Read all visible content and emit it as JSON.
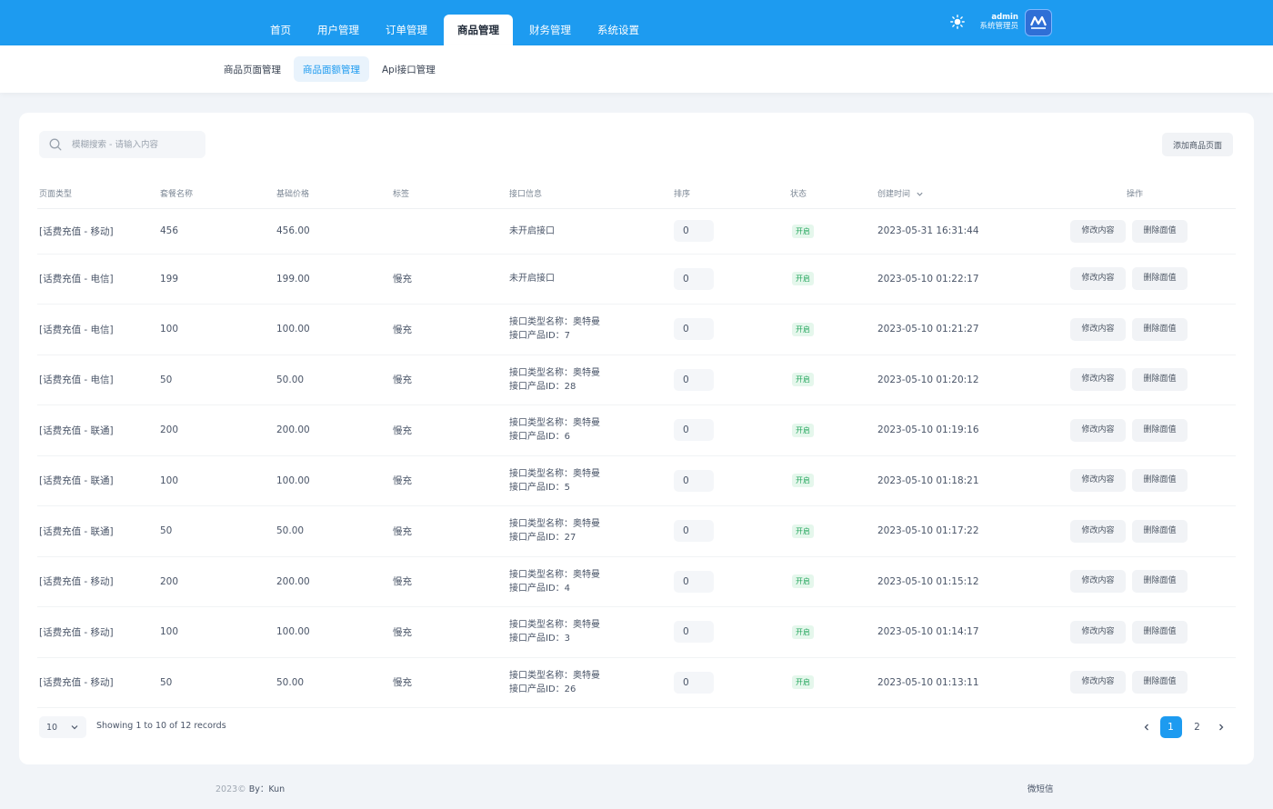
{
  "colors": {
    "primary": "#1d9bf0",
    "status_green": "#22a55b"
  },
  "nav": {
    "items": [
      "首页",
      "用户管理",
      "订单管理",
      "商品管理",
      "财务管理",
      "系统设置"
    ],
    "active": "商品管理"
  },
  "user": {
    "name": "admin",
    "role": "系统管理员",
    "avatar_icon": "logo-avatar-icon",
    "theme_icon": "sun-icon"
  },
  "subnav": {
    "items": [
      "商品页面管理",
      "商品面额管理",
      "Api接口管理"
    ],
    "active": "商品面额管理"
  },
  "toolbar": {
    "search_placeholder": "模糊搜索 - 请输入内容",
    "add_label": "添加商品页面"
  },
  "table": {
    "headers": [
      "页面类型",
      "套餐名称",
      "基础价格",
      "标签",
      "接口信息",
      "排序",
      "状态",
      "创建时间",
      "操作"
    ],
    "rows": [
      {
        "type": "[话费充值 - 移动]",
        "name": "456",
        "price": "456.00",
        "tag": "",
        "api1": "未开启接口",
        "api2": "",
        "sort": "0",
        "status": "开启",
        "time": "2023-05-31 16:31:44"
      },
      {
        "type": "[话费充值 - 电信]",
        "name": "199",
        "price": "199.00",
        "tag": "慢充",
        "api1": "未开启接口",
        "api2": "",
        "sort": "0",
        "status": "开启",
        "time": "2023-05-10 01:22:17"
      },
      {
        "type": "[话费充值 - 电信]",
        "name": "100",
        "price": "100.00",
        "tag": "慢充",
        "api1": "接口类型名称：奥特曼",
        "api2": "接口产品ID：7",
        "sort": "0",
        "status": "开启",
        "time": "2023-05-10 01:21:27"
      },
      {
        "type": "[话费充值 - 电信]",
        "name": "50",
        "price": "50.00",
        "tag": "慢充",
        "api1": "接口类型名称：奥特曼",
        "api2": "接口产品ID：28",
        "sort": "0",
        "status": "开启",
        "time": "2023-05-10 01:20:12"
      },
      {
        "type": "[话费充值 - 联通]",
        "name": "200",
        "price": "200.00",
        "tag": "慢充",
        "api1": "接口类型名称：奥特曼",
        "api2": "接口产品ID：6",
        "sort": "0",
        "status": "开启",
        "time": "2023-05-10 01:19:16"
      },
      {
        "type": "[话费充值 - 联通]",
        "name": "100",
        "price": "100.00",
        "tag": "慢充",
        "api1": "接口类型名称：奥特曼",
        "api2": "接口产品ID：5",
        "sort": "0",
        "status": "开启",
        "time": "2023-05-10 01:18:21"
      },
      {
        "type": "[话费充值 - 联通]",
        "name": "50",
        "price": "50.00",
        "tag": "慢充",
        "api1": "接口类型名称：奥特曼",
        "api2": "接口产品ID：27",
        "sort": "0",
        "status": "开启",
        "time": "2023-05-10 01:17:22"
      },
      {
        "type": "[话费充值 - 移动]",
        "name": "200",
        "price": "200.00",
        "tag": "慢充",
        "api1": "接口类型名称：奥特曼",
        "api2": "接口产品ID：4",
        "sort": "0",
        "status": "开启",
        "time": "2023-05-10 01:15:12"
      },
      {
        "type": "[话费充值 - 移动]",
        "name": "100",
        "price": "100.00",
        "tag": "慢充",
        "api1": "接口类型名称：奥特曼",
        "api2": "接口产品ID：3",
        "sort": "0",
        "status": "开启",
        "time": "2023-05-10 01:14:17"
      },
      {
        "type": "[话费充值 - 移动]",
        "name": "50",
        "price": "50.00",
        "tag": "慢充",
        "api1": "接口类型名称：奥特曼",
        "api2": "接口产品ID：26",
        "sort": "0",
        "status": "开启",
        "time": "2023-05-10 01:13:11"
      }
    ],
    "edit_label": "修改内容",
    "delete_label": "删除面值"
  },
  "pagination": {
    "page_size": "10",
    "records_text": "Showing 1 to 10 of 12 records",
    "pages": [
      "1",
      "2"
    ],
    "current": "1"
  },
  "footer": {
    "copyright": "2023©",
    "author": "By：Kun",
    "right_text": "微短信"
  }
}
